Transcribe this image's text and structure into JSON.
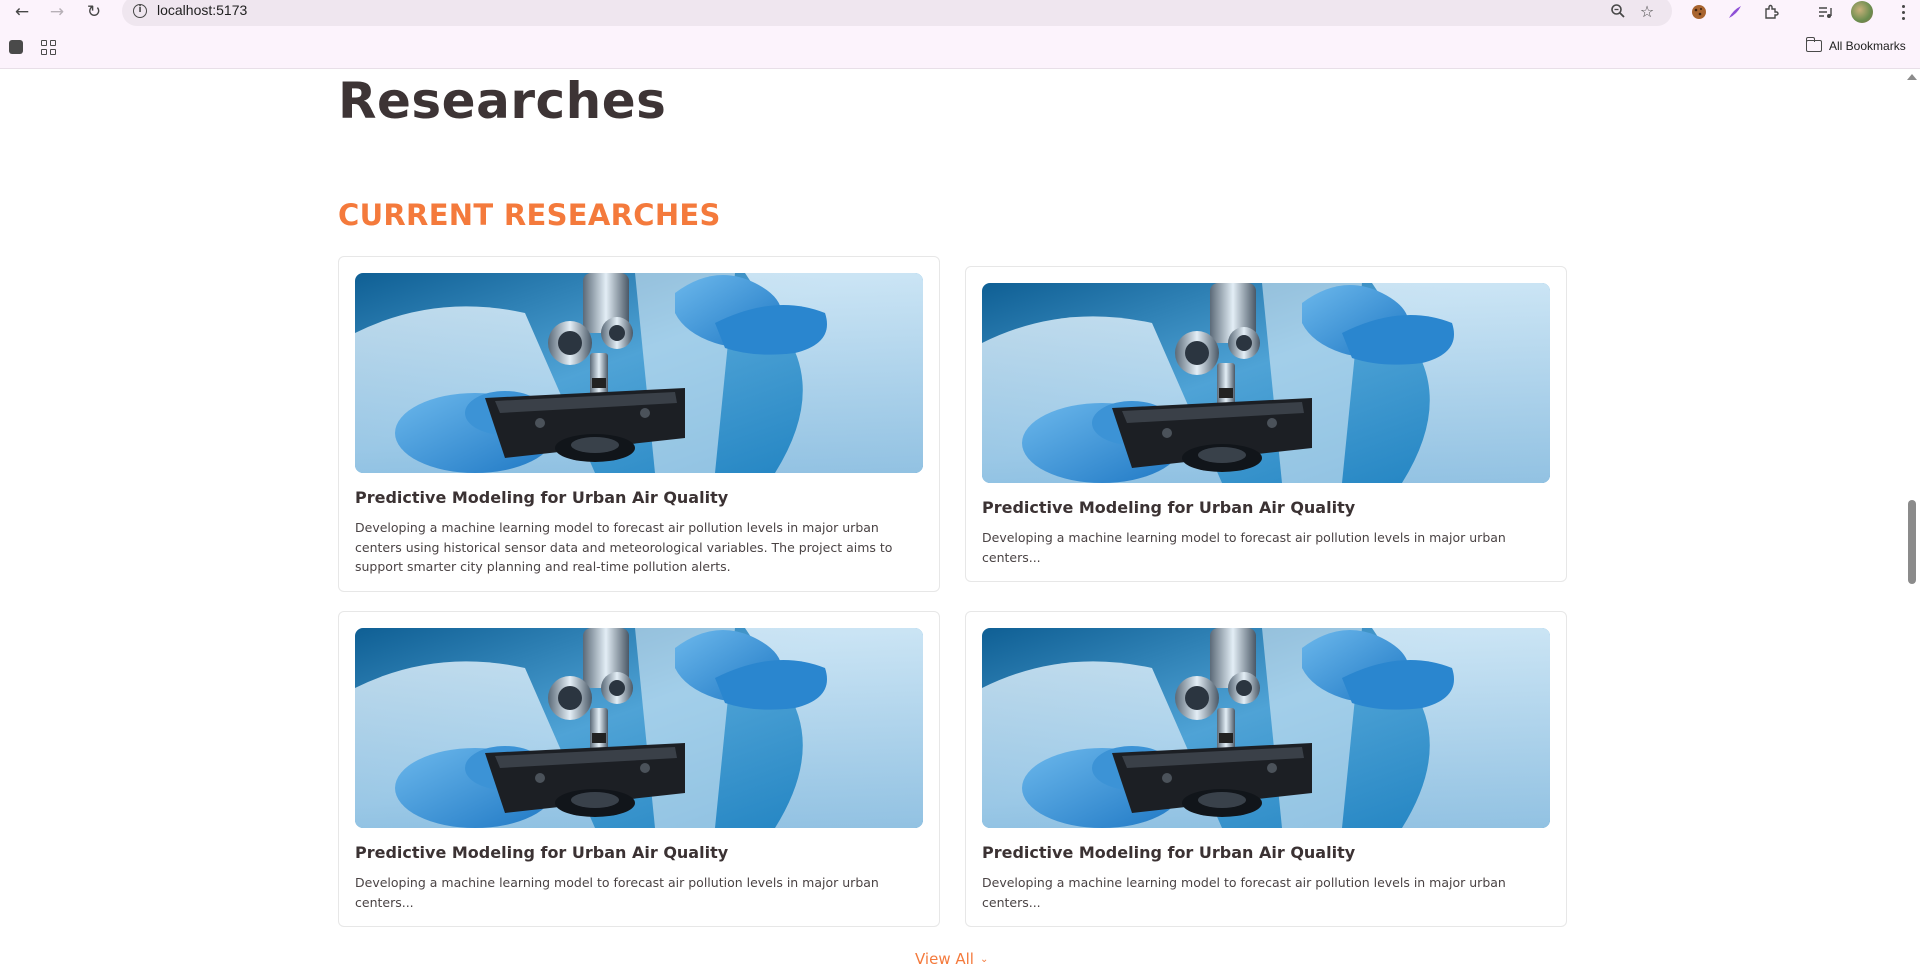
{
  "browser": {
    "url": "localhost:5173",
    "bookmarks_label": "All Bookmarks"
  },
  "page": {
    "title": "Researches",
    "section_title": "CURRENT RESEARCHES",
    "view_all_label": "View All",
    "accent_color": "#f47a3c",
    "cards": [
      {
        "title": "Predictive Modeling for Urban Air Quality",
        "description": "Developing a machine learning model to forecast air pollution levels in major urban centers using historical sensor data and meteorological variables. The project aims to support smarter city planning and real-time pollution alerts.",
        "image": "microscope-lab-photo"
      },
      {
        "title": "Predictive Modeling for Urban Air Quality",
        "description": "Developing a machine learning model to forecast air pollution levels in major urban centers...",
        "image": "microscope-lab-photo"
      },
      {
        "title": "Predictive Modeling for Urban Air Quality",
        "description": "Developing a machine learning model to forecast air pollution levels in major urban centers...",
        "image": "microscope-lab-photo"
      },
      {
        "title": "Predictive Modeling for Urban Air Quality",
        "description": "Developing a machine learning model to forecast air pollution levels in major urban centers...",
        "image": "microscope-lab-photo"
      }
    ]
  }
}
